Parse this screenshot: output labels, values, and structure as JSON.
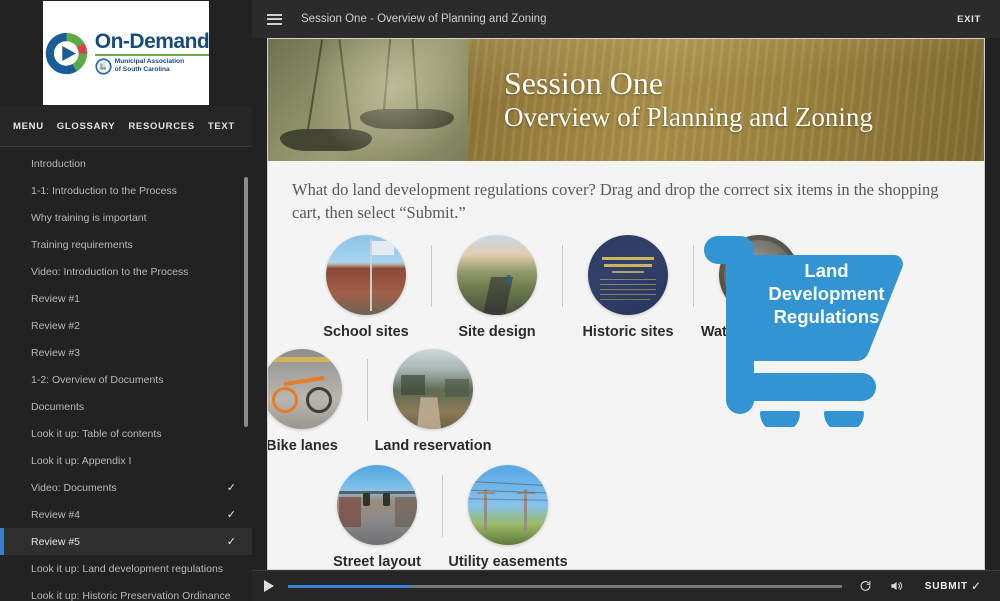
{
  "brand": {
    "logo_title": "On-Demand",
    "logo_sub_line1": "Municipal Association",
    "logo_sub_line2": "of South Carolina",
    "logo_mark_icon": "play-circle-logo-icon",
    "accent_blue": "#184a7c",
    "accent_green": "#6aa84f",
    "accent_red": "#d9414c"
  },
  "sidebar": {
    "tabs": [
      {
        "label": "MENU",
        "active": true
      },
      {
        "label": "GLOSSARY",
        "active": false
      },
      {
        "label": "RESOURCES",
        "active": false
      },
      {
        "label": "TEXT",
        "active": false
      }
    ],
    "active_tab_color": "#3a7fd5",
    "items": [
      {
        "label": "Introduction",
        "completed": false,
        "active": false
      },
      {
        "label": "1-1: Introduction to the Process",
        "completed": false,
        "active": false
      },
      {
        "label": "Why training is important",
        "completed": false,
        "active": false
      },
      {
        "label": "Training requirements",
        "completed": false,
        "active": false
      },
      {
        "label": "Video: Introduction to the Process",
        "completed": false,
        "active": false
      },
      {
        "label": "Review #1",
        "completed": false,
        "active": false
      },
      {
        "label": "Review #2",
        "completed": false,
        "active": false
      },
      {
        "label": "Review #3",
        "completed": false,
        "active": false
      },
      {
        "label": "1-2: Overview of Documents",
        "completed": false,
        "active": false
      },
      {
        "label": "Documents",
        "completed": false,
        "active": false
      },
      {
        "label": "Look it up: Table of contents",
        "completed": false,
        "active": false
      },
      {
        "label": "Look it up: Appendix I",
        "completed": false,
        "active": false
      },
      {
        "label": "Video: Documents",
        "completed": true,
        "active": false
      },
      {
        "label": "Review #4",
        "completed": true,
        "active": false
      },
      {
        "label": "Review #5",
        "completed": true,
        "active": true
      },
      {
        "label": "Look it up: Land development regulations",
        "completed": false,
        "active": false
      },
      {
        "label": "Look it up: Historic Preservation Ordinance",
        "completed": false,
        "active": false
      }
    ],
    "check_glyph": "✓"
  },
  "topbar": {
    "menu_icon": "hamburger-menu-icon",
    "title": "Session One - Overview of Planning and Zoning",
    "exit_label": "EXIT"
  },
  "slide": {
    "banner": {
      "image_alt": "scales-of-justice-image",
      "title_line1": "Session One",
      "title_line2": "Overview of Planning and Zoning"
    },
    "instruction": "What do land development regulations cover? Drag and drop the correct six items in the shopping cart, then select “Submit.”",
    "rows": [
      [
        {
          "label": "School sites",
          "art": "art-school",
          "icon": "school-building-photo"
        },
        {
          "label": "Site design",
          "art": "art-sitedesign",
          "icon": "rural-road-photo"
        },
        {
          "label": "Historic sites",
          "art": "art-historic",
          "icon": "historic-marker-photo"
        },
        {
          "label": "Water and Sewer",
          "art": "art-sewer",
          "icon": "sewer-manhole-photo"
        }
      ],
      [
        {
          "label": "Bike lanes",
          "art": "art-bike",
          "icon": "orange-bicycle-photo"
        },
        {
          "label": "Land reservation",
          "art": "art-landres",
          "icon": "boardwalk-mountains-photo"
        }
      ],
      [
        {
          "label": "Street layout",
          "art": "art-street",
          "icon": "downtown-street-photo"
        },
        {
          "label": "Utility easements",
          "art": "art-utility",
          "icon": "power-lines-photo"
        }
      ]
    ],
    "cart": {
      "icon": "shopping-cart-icon",
      "color": "#3294d2",
      "label_line1": "Land",
      "label_line2": "Development",
      "label_line3": "Regulations"
    }
  },
  "controls": {
    "play_icon": "play-icon",
    "progress_percent": 22,
    "progress_color": "#3a7fd5",
    "replay_icon": "replay-icon",
    "volume_icon": "volume-icon",
    "submit_label": "SUBMIT",
    "submit_check": "✓"
  }
}
